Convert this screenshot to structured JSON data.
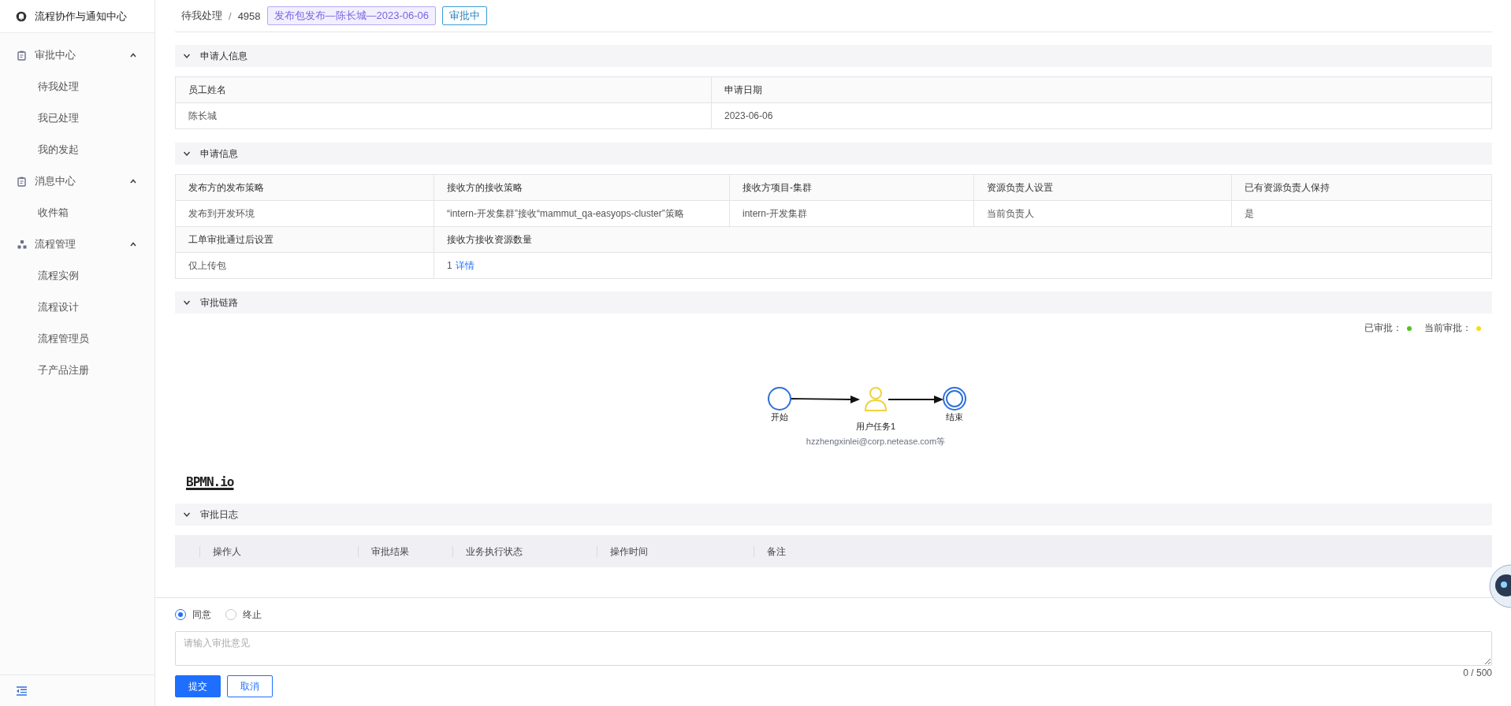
{
  "sidebar": {
    "title": "流程协作与通知中心",
    "groups": [
      {
        "label": "审批中心",
        "kind": "clipboard",
        "expanded": true,
        "items": [
          {
            "label": "待我处理",
            "selected": false
          },
          {
            "label": "我已处理",
            "selected": false
          },
          {
            "label": "我的发起",
            "selected": false
          }
        ]
      },
      {
        "label": "消息中心",
        "kind": "clipboard",
        "expanded": true,
        "items": [
          {
            "label": "收件箱",
            "selected": false
          }
        ]
      },
      {
        "label": "流程管理",
        "kind": "hierarchy",
        "expanded": true,
        "items": [
          {
            "label": "流程实例",
            "selected": false
          },
          {
            "label": "流程设计",
            "selected": false
          },
          {
            "label": "流程管理员",
            "selected": false
          },
          {
            "label": "子产品注册",
            "selected": false
          }
        ]
      }
    ]
  },
  "breadcrumb": {
    "items": [
      "待我处理",
      "4958"
    ],
    "separator": "/",
    "tag": "发布包发布—陈长城—2023-06-06",
    "status": "审批中"
  },
  "applicant": {
    "title": "申请人信息",
    "expanded": true,
    "fields": [
      {
        "label": "员工姓名",
        "value": "陈长城"
      },
      {
        "label": "申请日期",
        "value": "2023-06-06"
      }
    ]
  },
  "request": {
    "title": "申请信息",
    "expanded": true,
    "fields": [
      {
        "label": "发布方的发布策略",
        "value": "发布到开发环境"
      },
      {
        "label": "接收方的接收策略",
        "value": "“intern-开发集群”接收“mammut_qa-easyops-cluster”策略"
      },
      {
        "label": "接收方项目-集群",
        "value": "intern-开发集群"
      },
      {
        "label": "资源负责人设置",
        "value": "当前负责人"
      },
      {
        "label": "已有资源负责人保持",
        "value": "是"
      },
      {
        "label": "工单审批通过后设置",
        "value": "仅上传包"
      },
      {
        "label": "接收方接收资源数量",
        "value": "1",
        "link": "详情"
      }
    ]
  },
  "chain": {
    "title": "审批链路",
    "expanded": true,
    "legend": [
      {
        "label": "已审批：",
        "color": "#52c41a"
      },
      {
        "label": "当前审批：",
        "color": "#fadb14"
      }
    ],
    "nodes": [
      {
        "kind": "start",
        "label": "开始"
      },
      {
        "kind": "user_task",
        "label": "用户任务1",
        "assignee": "hzzhengxinlei@corp.netease.com等"
      },
      {
        "kind": "end",
        "label": "结束"
      }
    ],
    "logo": "BPMN.io"
  },
  "log": {
    "title": "审批日志",
    "expanded": true,
    "columns": [
      "操作人",
      "审批结果",
      "业务执行状态",
      "操作时间",
      "备注"
    ]
  },
  "footer": {
    "options": [
      {
        "label": "同意",
        "selected": true
      },
      {
        "label": "终止",
        "selected": false
      }
    ],
    "placeholder": "请输入审批意见",
    "counter": "0 / 500",
    "buttons": [
      {
        "label": "提交",
        "kind": "primary"
      },
      {
        "label": "取消",
        "kind": "default"
      }
    ]
  }
}
